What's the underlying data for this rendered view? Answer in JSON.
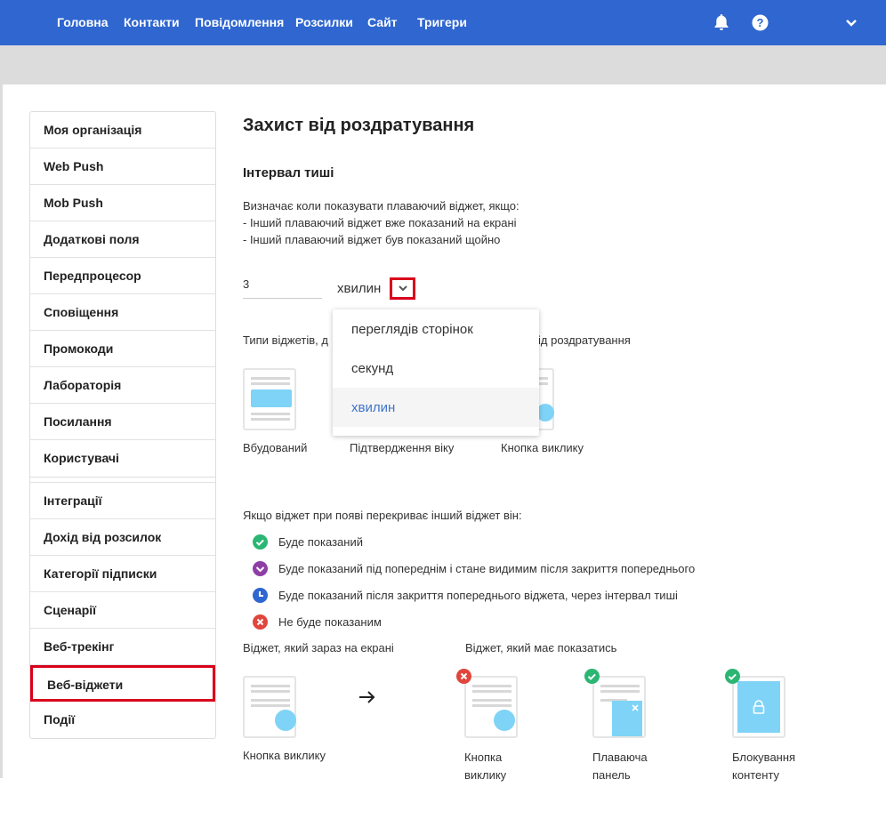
{
  "topnav": {
    "items": [
      "Головна",
      "Контакти",
      "Повідомлення",
      "Розсилки",
      "Сайт",
      "Тригери"
    ],
    "icons": [
      "bell-icon",
      "help-icon",
      "chevron-down-icon"
    ],
    "bg_color": "#2f66d0"
  },
  "sidebar": {
    "group1": [
      "Моя організація",
      "Web Push",
      "Mob Push",
      "Додаткові поля",
      "Передпроцесор",
      "Сповіщення",
      "Промокоди",
      "Лабораторія",
      "Посилання",
      "Користувачі"
    ],
    "group2": [
      "Інтеграції",
      "Дохід від розсилок",
      "Категорії підписки",
      "Сценарії",
      "Веб-трекінг",
      "Веб-віджети",
      "Події"
    ],
    "active": "Веб-віджети"
  },
  "main": {
    "title": "Захист від роздратування",
    "section_title": "Інтервал тиші",
    "desc_line1": "Визначає коли показувати плаваючий віджет, якщо:",
    "desc_line2": "- Інший плаваючий віджет вже показаний на екрані",
    "desc_line3": "- Інший плаваючий віджет був показаний щойно",
    "interval_value": "3",
    "unit_selected": "хвилин",
    "types_label_left": "Типи віджетів, д",
    "types_label_right": "ід роздратування"
  },
  "dropdown": {
    "options": [
      "переглядів сторінок",
      "секунд",
      "хвилин"
    ],
    "selected": "хвилин"
  },
  "widget_types": [
    "Вбудований",
    "Підтвердження віку",
    "Кнопка виклику"
  ],
  "overlap": {
    "question": "Якщо віджет при появі перекриває інший віджет він:",
    "legend": [
      {
        "text": "Буде показаний",
        "color": "#2bb673",
        "icon": "check-icon"
      },
      {
        "text": "Буде показаний під попереднім і стане видимим після закриття попереднього",
        "color": "#8e3fa6",
        "icon": "check-icon"
      },
      {
        "text": "Буде показаний після закриття попереднього віджета, через інтервал тиші",
        "color": "#2f66d0",
        "icon": "clock-icon"
      },
      {
        "text": "Не буде показаним",
        "color": "#e0463c",
        "icon": "close-icon"
      }
    ],
    "current_label": "Віджет, який зараз на екрані",
    "next_label": "Віджет, який має показатись",
    "current_widget": "Кнопка виклику",
    "next_widgets": [
      {
        "line1": "Кнопка",
        "line2": "виклику",
        "status": "close-icon"
      },
      {
        "line1": "Плаваюча",
        "line2": "панель",
        "status": "check-icon"
      },
      {
        "line1": "Блокування",
        "line2": "контенту",
        "status": "check-icon"
      }
    ]
  },
  "colors": {
    "accent": "#2f66d0",
    "highlight_box": "#d9001b",
    "widget_blue": "#7fd3f7",
    "green": "#2bb673",
    "red": "#e0463c"
  }
}
